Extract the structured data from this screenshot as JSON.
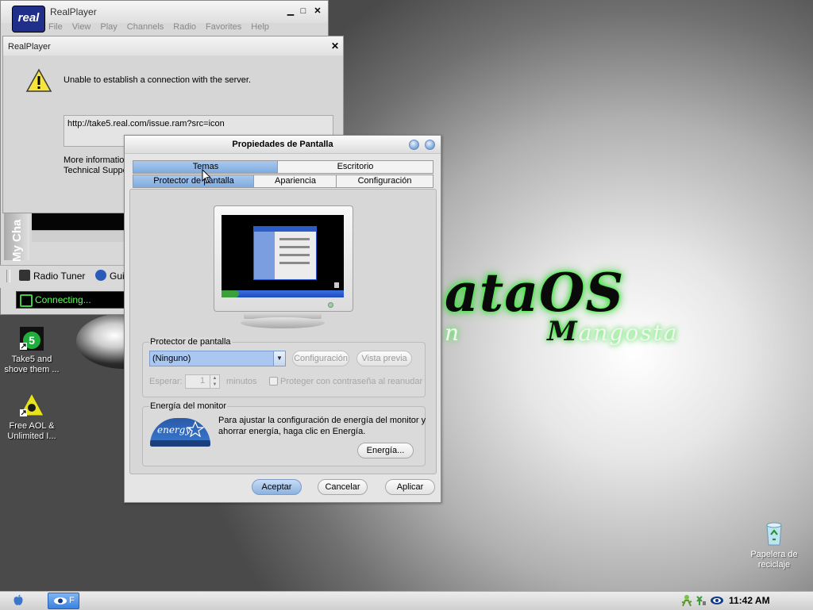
{
  "desktop": {
    "logo_text": "ataOS",
    "logo_sub_initial": "M",
    "logo_sub_rest": "angosta",
    "logo_left_letter": "n",
    "icons": [
      {
        "label_line1": "Take5 and",
        "label_line2": "shove them ..."
      },
      {
        "label_line1": "Free AOL &",
        "label_line2": "Unlimited I..."
      },
      {
        "label_line1": "Papelera de",
        "label_line2": "reciclaje"
      }
    ]
  },
  "realplayer": {
    "logo": "real",
    "title": "RealPlayer",
    "menu": [
      "File",
      "View",
      "Play",
      "Channels",
      "Radio",
      "Favorites",
      "Help"
    ],
    "side_tab": "My Cha",
    "radio_tuner": "Radio Tuner",
    "guide": "Gui",
    "status": "Connecting..."
  },
  "error_dialog": {
    "title": "RealPlayer",
    "message": "Unable to establish a connection with the server.",
    "url": "http://take5.real.com/issue.ram?src=icon",
    "more_line1": "More information",
    "more_line2": "Technical Suppo"
  },
  "display_props": {
    "title": "Propiedades de Pantalla",
    "tabs_row1": [
      "Temas",
      "Escritorio"
    ],
    "tabs_row2": [
      "Protector de pantalla",
      "Apariencia",
      "Configuración"
    ],
    "selected_tab": "Protector de pantalla",
    "screensaver": {
      "group_title": "Protector de pantalla",
      "selected": "(Ninguno)",
      "config_button": "Configuración",
      "preview_button": "Vista previa",
      "wait_label": "Esperar:",
      "wait_value": "1",
      "minutes_label": "minutos",
      "password_label": "Proteger con contraseña al reanudar"
    },
    "energy": {
      "group_title": "Energía del monitor",
      "text_line1": "Para ajustar la configuración de energía del monitor y",
      "text_line2": "ahorrar energía, haga clic en Energía.",
      "button": "Energía...",
      "logo_text": "energy"
    },
    "buttons": {
      "ok": "Aceptar",
      "cancel": "Cancelar",
      "apply": "Aplicar"
    }
  },
  "taskbar": {
    "task_label": "F",
    "clock": "11:42 AM"
  },
  "colors": {
    "accent": "#7fabe0",
    "logo_glow": "#3cff3c",
    "status_green": "#5cff5c"
  }
}
